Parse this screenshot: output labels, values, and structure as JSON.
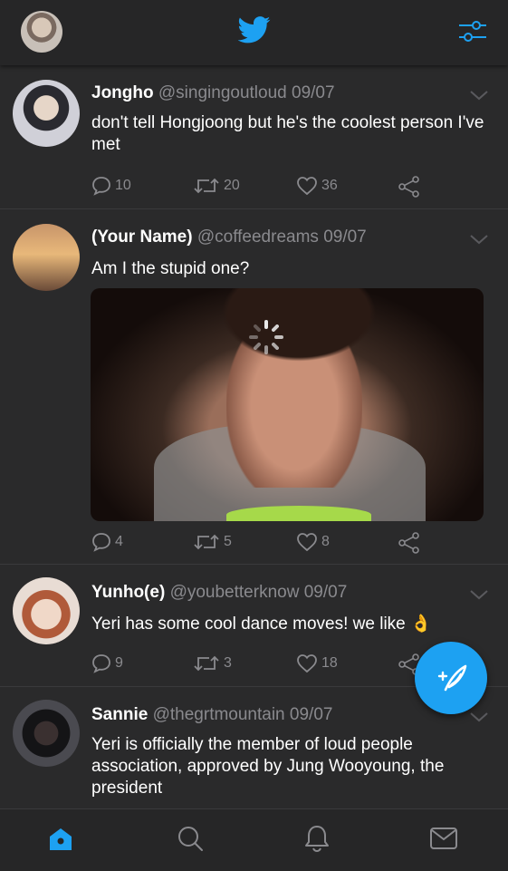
{
  "app": {
    "brand_color": "#1da1f2",
    "background": "#2a2a2b"
  },
  "header": {
    "logo_icon": "twitter-bird-icon",
    "filter_icon": "filter-sliders-icon"
  },
  "tweets": [
    {
      "name": "Jongho",
      "handle": "@singingoutloud",
      "date": "09/07",
      "text": "don't tell Hongjoong but he's the coolest person I've met",
      "replies": "10",
      "retweets": "20",
      "likes": "36"
    },
    {
      "name": "(Your Name)",
      "handle": "@coffeedreams",
      "date": "09/07",
      "text": "Am I the stupid one?",
      "replies": "4",
      "retweets": "5",
      "likes": "8"
    },
    {
      "name": "Yunho(e)",
      "handle": "@youbetterknow",
      "date": "09/07",
      "text": "Yeri has some cool dance moves! we like 👌",
      "replies": "9",
      "retweets": "3",
      "likes": "18"
    },
    {
      "name": "Sannie",
      "handle": "@thegrtmountain",
      "date": "09/07",
      "text": "Yeri is officially the member of loud people association, approved by Jung Wooyoung, the president"
    }
  ],
  "nav": {
    "items": [
      "home-icon",
      "search-icon",
      "notifications-bell-icon",
      "messages-envelope-icon"
    ],
    "active": "home-icon"
  },
  "fab": {
    "icon": "compose-tweet-icon"
  }
}
